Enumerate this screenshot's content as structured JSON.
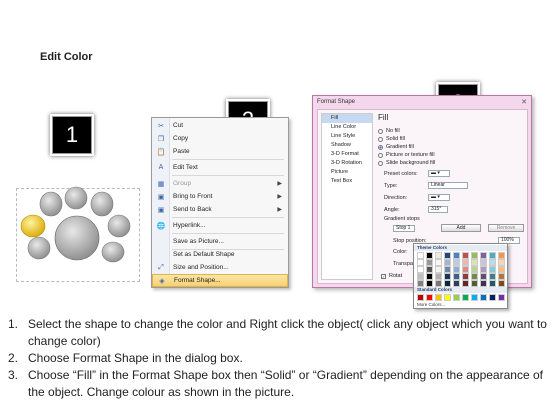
{
  "title": "Edit Color",
  "badges": {
    "step1": "1",
    "step2": "2",
    "step3": "3"
  },
  "context_menu": {
    "items": [
      {
        "label": "Cut",
        "icon": "cut-icon",
        "enabled": true,
        "submenu": false
      },
      {
        "label": "Copy",
        "icon": "copy-icon",
        "enabled": true,
        "submenu": false
      },
      {
        "label": "Paste",
        "icon": "paste-icon",
        "enabled": true,
        "submenu": false
      },
      {
        "label": "Edit Text",
        "icon": "edit-text-icon",
        "enabled": true,
        "submenu": false
      },
      {
        "label": "Group",
        "icon": "group-icon",
        "enabled": false,
        "submenu": true
      },
      {
        "label": "Bring to Front",
        "icon": "bring-front-icon",
        "enabled": true,
        "submenu": true
      },
      {
        "label": "Send to Back",
        "icon": "send-back-icon",
        "enabled": true,
        "submenu": true
      },
      {
        "label": "Hyperlink...",
        "icon": "hyperlink-icon",
        "enabled": true,
        "submenu": false
      },
      {
        "label": "Save as Picture...",
        "icon": "",
        "enabled": true,
        "submenu": false
      },
      {
        "label": "Set as Default Shape",
        "icon": "",
        "enabled": true,
        "submenu": false
      },
      {
        "label": "Size and Position...",
        "icon": "size-position-icon",
        "enabled": true,
        "submenu": false
      },
      {
        "label": "Format Shape...",
        "icon": "format-shape-icon",
        "enabled": true,
        "submenu": false,
        "highlighted": true
      }
    ]
  },
  "format_dialog": {
    "title": "Format Shape",
    "categories": [
      "Fill",
      "Line Color",
      "Line Style",
      "Shadow",
      "3-D Format",
      "3-D Rotation",
      "Picture",
      "Text Box"
    ],
    "selected_category": "Fill",
    "pane_title": "Fill",
    "fill_options": [
      "No fill",
      "Solid fill",
      "Gradient fill",
      "Picture or texture fill",
      "Slide background fill"
    ],
    "selected_fill": "Gradient fill",
    "preset_colors_label": "Preset colors:",
    "type_label": "Type:",
    "type_value": "Linear",
    "direction_label": "Direction:",
    "angle_label": "Angle:",
    "angle_value": "315°",
    "gradient_stops_label": "Gradient stops",
    "stop_value": "Stop 1",
    "add_label": "Add",
    "remove_label": "Remove",
    "stop_position_label": "Stop position:",
    "stop_position_value": "100%",
    "color_label": "Color:",
    "transparency_label": "Transpa",
    "rotate_label": "Rotat"
  },
  "color_palette": {
    "theme_header": "Theme Colors",
    "standard_header": "Standard Colors",
    "more_label": "More Colors...",
    "theme_top_row": [
      "#ffffff",
      "#000000",
      "#eeece1",
      "#1f497d",
      "#4f81bd",
      "#c0504d",
      "#9bbb59",
      "#8064a2",
      "#4bacc6",
      "#f79646"
    ],
    "standard_row": [
      "#c00000",
      "#ff0000",
      "#ffc000",
      "#ffff00",
      "#92d050",
      "#00b050",
      "#00b0f0",
      "#0070c0",
      "#002060",
      "#7030a0"
    ]
  },
  "steps": [
    {
      "num": "1.",
      "text": "Select the shape to change the color and Right click the object( click any object which you want to change color)"
    },
    {
      "num": "2.",
      "text": "Choose Format Shape in the dialog box."
    },
    {
      "num": "3.",
      "text": "Choose “Fill” in the Format Shape box then “Solid” or “Gradient” depending on the appearance of the object. Change colour as shown in the picture."
    }
  ],
  "colors": {
    "accent_yellow": "#f2c200",
    "petal_gray": "#bdbdbd",
    "dialog_pink": "#f4d7ec"
  }
}
